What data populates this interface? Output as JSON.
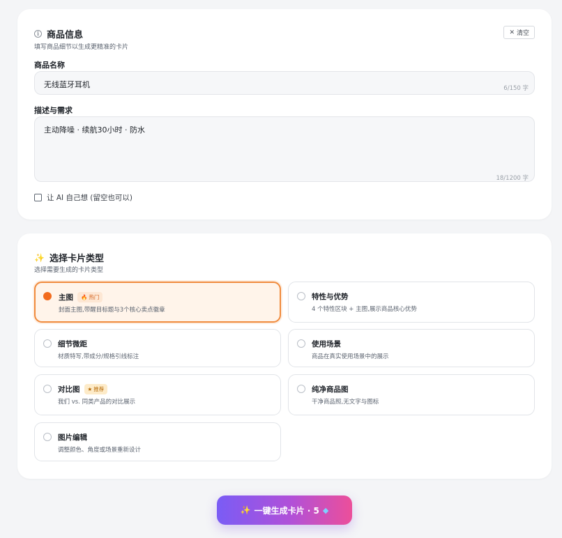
{
  "product": {
    "title": "商品信息",
    "subtitle": "填写商品细节以生成更精准的卡片",
    "clear_label": "清空",
    "name_label": "商品名称",
    "name_value": "无线蓝牙耳机",
    "name_counter": "6/150 字",
    "desc_label": "描述与需求",
    "desc_value": "主动降噪 · 续航30小时 · 防水",
    "desc_counter": "18/1200 字",
    "ai_checkbox_label": "让 AI 自己想 (留空也可以)",
    "ai_checked": false
  },
  "card_types": {
    "title": "选择卡片类型",
    "subtitle": "选择需要生成的卡片类型",
    "options": [
      {
        "title": "主图",
        "desc": "封面主图,带醒目标题与3个核心卖点徽章",
        "badge": "热门",
        "selected": true
      },
      {
        "title": "特性与优势",
        "desc": "4 个特性区块 + 主图,展示商品核心优势",
        "selected": false
      },
      {
        "title": "细节微距",
        "desc": "材质特写,带成分/规格引线标注",
        "selected": false
      },
      {
        "title": "使用场景",
        "desc": "商品在真实使用场景中的展示",
        "selected": false
      },
      {
        "title": "对比图",
        "desc": "我们 vs. 同类产品的对比展示",
        "badge": "推荐",
        "selected": false
      },
      {
        "title": "纯净商品图",
        "desc": "干净商品照,无文字与图标",
        "selected": false
      },
      {
        "title": "图片编辑",
        "desc": "调整颜色、角度或场景重新设计",
        "selected": false
      }
    ]
  },
  "generate": {
    "label": "一键生成卡片 · 5"
  },
  "colors": {
    "accent_orange": "#f26b1d",
    "gradient_start": "#7a5cf5",
    "gradient_end": "#ec4f9a"
  },
  "icons": {
    "info": "info-icon",
    "clear": "close-icon",
    "sparkle": "sparkle-icon",
    "hot": "fire-icon",
    "recommend": "star-icon",
    "gem": "gem-icon"
  }
}
